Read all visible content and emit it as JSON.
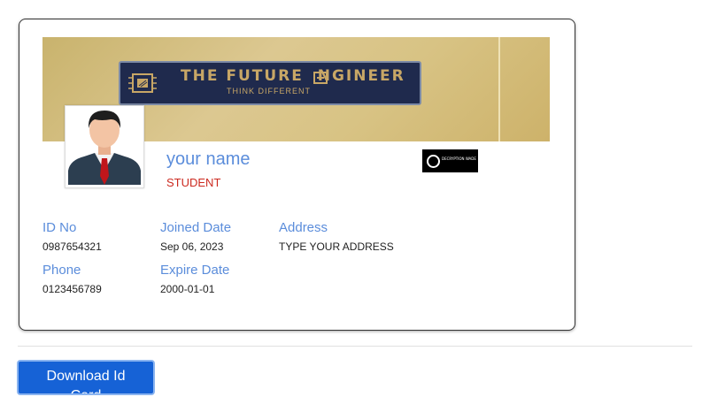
{
  "card": {
    "logo": {
      "title": "THE FUTURE  NGINEER",
      "tagline": "THINK DIFFERENT"
    },
    "name": "your name",
    "role": "STUDENT",
    "qr_badge_text": "DECRYPTION WADE",
    "fields": {
      "id": {
        "label": "ID No",
        "value": "0987654321"
      },
      "joined": {
        "label": "Joined Date",
        "value": "Sep 06, 2023"
      },
      "address": {
        "label": "Address",
        "value": "TYPE YOUR ADDRESS"
      },
      "phone": {
        "label": "Phone",
        "value": "0123456789"
      },
      "expire": {
        "label": "Expire Date",
        "value": "2000-01-01"
      }
    }
  },
  "download_button": {
    "label": "Download Id Card"
  },
  "colors": {
    "accent_blue": "#5b8ddb",
    "role_red": "#cc2a20",
    "button_blue": "#1662d6",
    "logo_gold": "#c8a766",
    "logo_navy": "#1f2a4d"
  }
}
